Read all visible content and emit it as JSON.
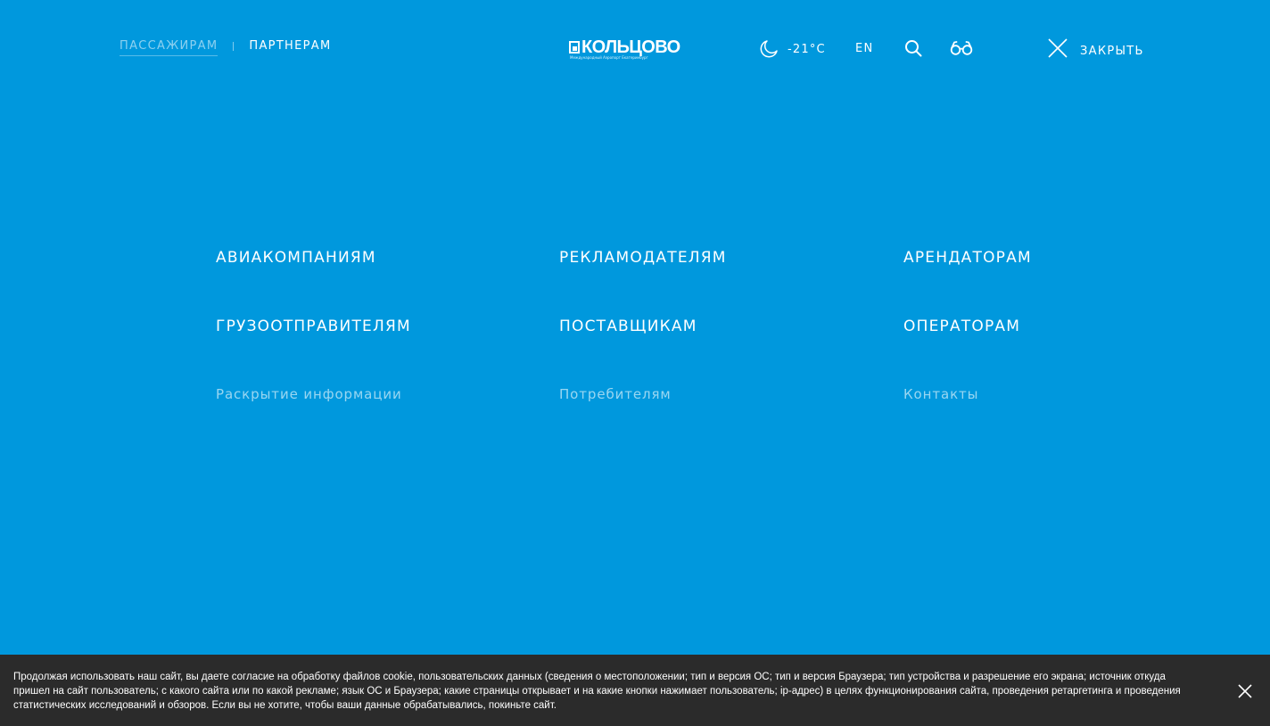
{
  "header": {
    "audience_tabs": [
      {
        "label": "Пассажирам",
        "active": false
      },
      {
        "label": "Партнерам",
        "active": true
      }
    ],
    "logo": {
      "text": "КОЛЬЦОВО",
      "subtitle": "Международный Аэропорт Екатеринбург"
    },
    "weather": {
      "icon": "moon-icon",
      "temperature": "-21°C"
    },
    "language_label": "EN",
    "search_icon": "search-icon",
    "accessibility_icon": "glasses-icon",
    "close_label": "Закрыть",
    "close_icon": "close-icon"
  },
  "menu": {
    "columns": [
      {
        "items": [
          "Авиакомпаниям",
          "Грузоотправителям"
        ],
        "secondary": "Раскрытие информации"
      },
      {
        "items": [
          "Рекламодателям",
          "Поставщикам"
        ],
        "secondary": "Потребителям"
      },
      {
        "items": [
          "Арендаторам",
          "Операторам"
        ],
        "secondary": "Контакты"
      }
    ]
  },
  "cookie_notice": {
    "text": "Продолжая использовать наш сайт, вы даете согласие на обработку файлов cookie, пользовательских данных (сведения о местоположении; тип и версия ОС; тип и версия Браузера; тип устройства и разрешение его экрана; источник откуда пришел на сайт пользователь; с какого сайта или по какой рекламе; язык ОС и Браузера; какие страницы открывает и на какие кнопки нажимает пользователь; ip-адрес) в целях функционирования сайта, проведения ретаргетинга и проведения статистических исследований и обзоров. Если вы не хотите, чтобы ваши данные обрабатывались, покиньте сайт.",
    "close_icon": "close-icon"
  },
  "colors": {
    "background": "#0098dd",
    "cookie_bar": "#2b2b2b",
    "text": "#ffffff"
  }
}
